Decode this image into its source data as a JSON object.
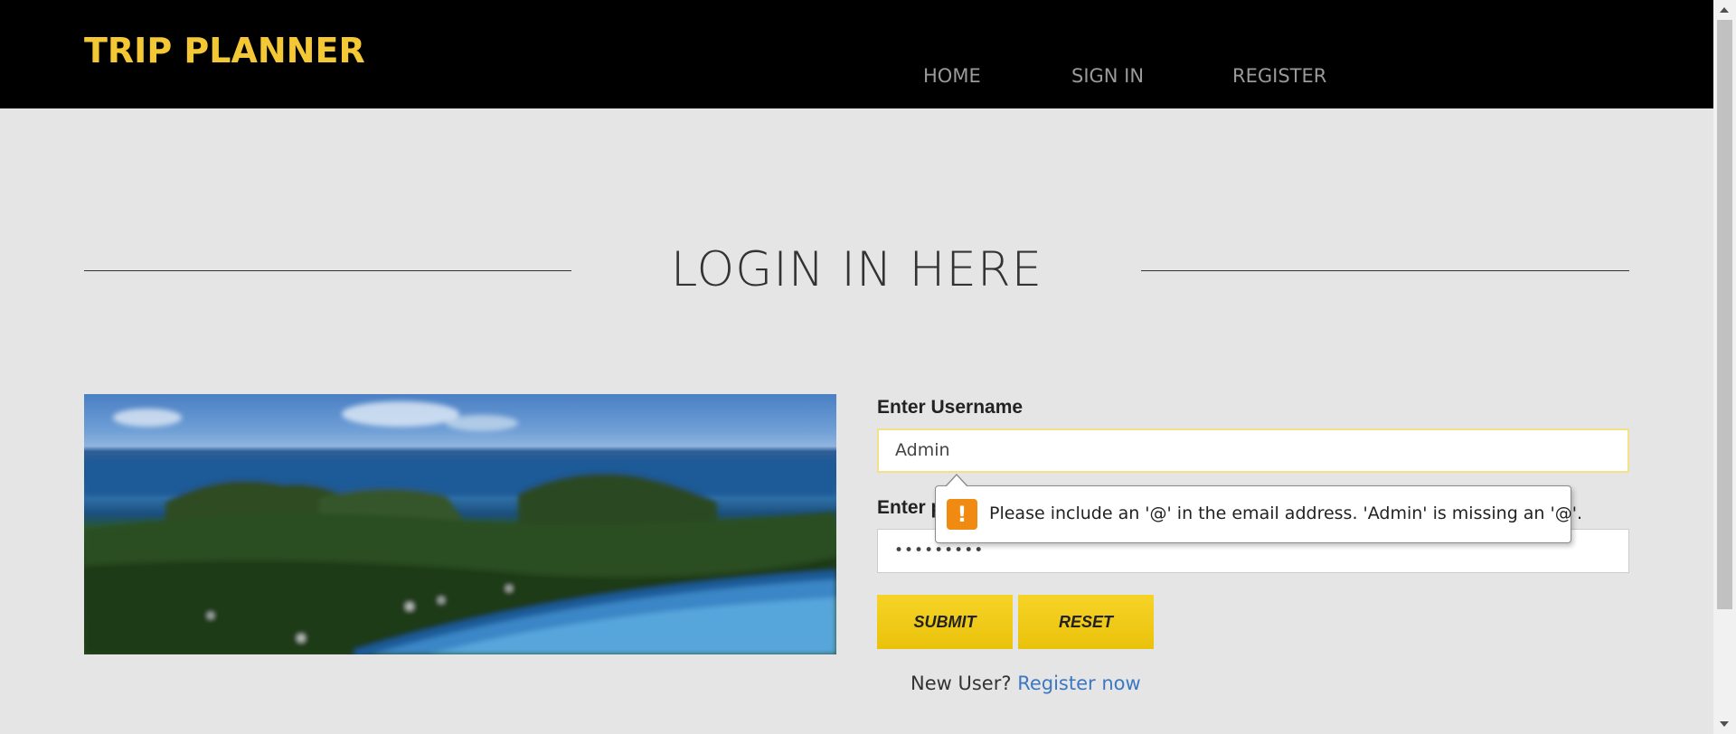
{
  "header": {
    "brand": "TRIP PLANNER",
    "nav": [
      "HOME",
      "SIGN IN",
      "REGISTER"
    ]
  },
  "page": {
    "title": "LOGIN IN HERE"
  },
  "form": {
    "username_label": "Enter Username",
    "username_value": "Admin",
    "password_label": "Enter password",
    "password_value": "•••••••••",
    "submit_label": "SUBMIT",
    "reset_label": "RESET",
    "new_user_text": "New User?",
    "register_link": "Register now"
  },
  "validation": {
    "icon": "warning-icon",
    "glyph": "!",
    "message": "Please include an '@' in the email address. 'Admin' is missing an '@'."
  },
  "colors": {
    "brand": "#f4c835",
    "button": "#f2cc1b",
    "link": "#3b78c4",
    "warning": "#f08a10"
  }
}
